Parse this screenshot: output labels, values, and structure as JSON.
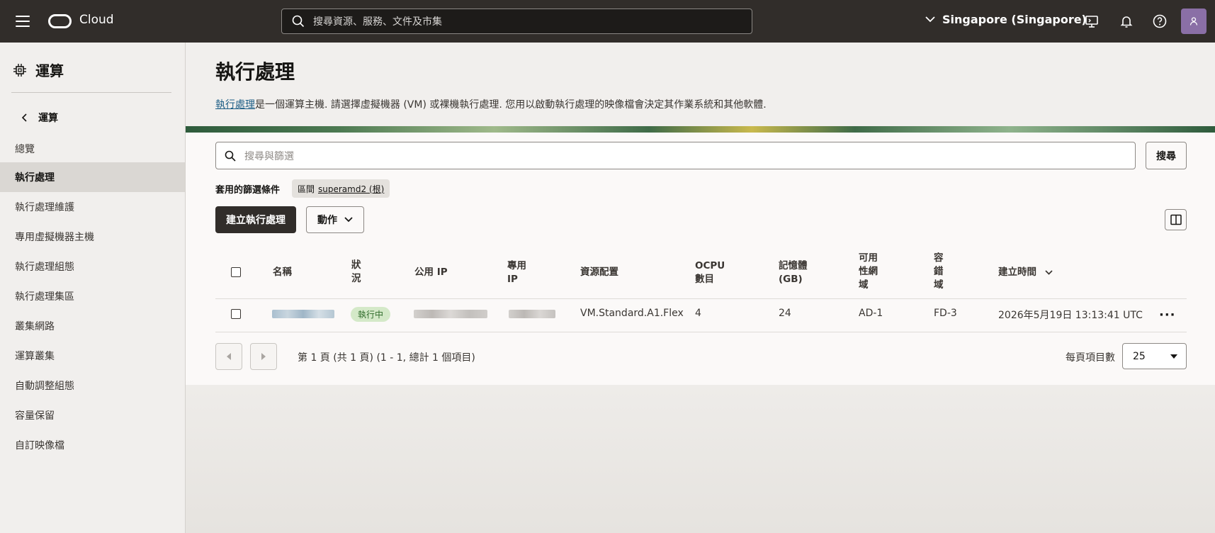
{
  "topbar": {
    "brand": "Cloud",
    "search_placeholder": "搜尋資源、服務、文件及市集",
    "region": "Singapore (Singapore)"
  },
  "sidebar": {
    "header": "運算",
    "back_label": "運算",
    "items": [
      {
        "label": "總覽",
        "active": false
      },
      {
        "label": "執行處理",
        "active": true
      },
      {
        "label": "執行處理維護",
        "active": false
      },
      {
        "label": "專用虛擬機器主機",
        "active": false
      },
      {
        "label": "執行處理組態",
        "active": false
      },
      {
        "label": "執行處理集區",
        "active": false
      },
      {
        "label": "叢集網路",
        "active": false
      },
      {
        "label": "運算叢集",
        "active": false
      },
      {
        "label": "自動調整組態",
        "active": false
      },
      {
        "label": "容量保留",
        "active": false
      },
      {
        "label": "自訂映像檔",
        "active": false
      }
    ]
  },
  "main": {
    "title": "執行處理",
    "description_link": "執行處理",
    "description_rest": "是一個運算主機. 請選擇虛擬機器 (VM) 或裸機執行處理. 您用以啟動執行處理的映像檔會決定其作業系統和其他軟體.",
    "filter_placeholder": "搜尋與篩選",
    "search_button": "搜尋",
    "applied_filters_label": "套用的篩選條件",
    "chip_key": "區間",
    "chip_value": "superamd2 (根)",
    "create_button": "建立執行處理",
    "actions_button": "動作"
  },
  "table": {
    "headers": {
      "name": "名稱",
      "state": [
        "狀",
        "況"
      ],
      "public_ip": "公用 IP",
      "private_ip": [
        "專用",
        "IP"
      ],
      "shape": "資源配置",
      "ocpu": [
        "OCPU",
        "數目"
      ],
      "memory": [
        "記憶體",
        "(GB)"
      ],
      "ad": [
        "可用",
        "性網",
        "域"
      ],
      "fd": [
        "容",
        "錯",
        "域"
      ],
      "created": "建立時間"
    },
    "rows": [
      {
        "state": "執行中",
        "shape": "VM.Standard.A1.Flex",
        "ocpu": "4",
        "memory": "24",
        "ad": "AD-1",
        "fd": "FD-3",
        "created": "2026年5月19日 13:13:41 UTC"
      }
    ]
  },
  "pagination": {
    "summary": "第 1 頁 (共 1 頁) (1 - 1, 總計 1 個項目)",
    "per_page_label": "每頁項目數",
    "per_page_value": "25"
  }
}
